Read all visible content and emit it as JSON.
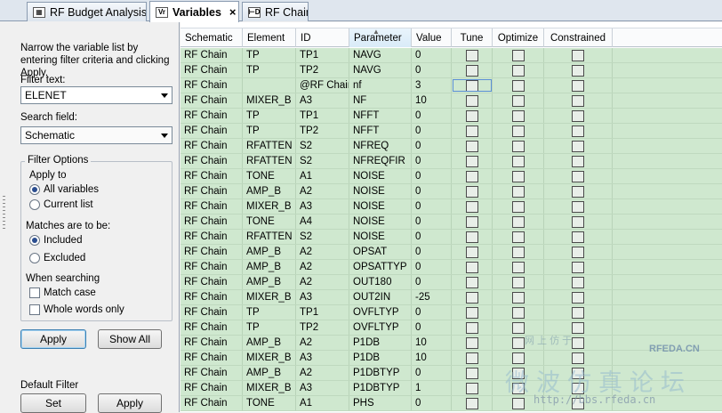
{
  "tabs": [
    {
      "label": "RF Budget Analysis",
      "icon": "chart-icon"
    },
    {
      "label": "Variables",
      "icon": "variables-icon",
      "close": "×"
    },
    {
      "label": "RF Chain",
      "icon": "schematic-icon"
    }
  ],
  "filter_panel": {
    "intro": "Narrow the variable list by entering filter criteria and clicking Apply.",
    "filter_text_label": "Filter text:",
    "filter_text_value": "ELENET",
    "search_field_label": "Search field:",
    "search_field_value": "Schematic",
    "filter_options_title": "Filter Options",
    "apply_to_label": "Apply to",
    "all_variables": "All variables",
    "current_list": "Current list",
    "matches_label": "Matches are to be:",
    "included": "Included",
    "excluded": "Excluded",
    "when_searching_label": "When searching",
    "match_case": "Match case",
    "whole_words": "Whole words only",
    "apply_button": "Apply",
    "show_all_button": "Show All",
    "default_filter_label": "Default Filter",
    "set_button": "Set",
    "apply_default_button": "Apply",
    "selected_apply_to": "All variables",
    "selected_matches": "Included"
  },
  "grid": {
    "columns": [
      "Schematic",
      "Element",
      "ID",
      "Parameter",
      "Value",
      "Tune",
      "Optimize",
      "Constrained"
    ],
    "rows": [
      [
        "RF Chain",
        "TP",
        "TP1",
        "NAVG",
        "0"
      ],
      [
        "RF Chain",
        "TP",
        "TP2",
        "NAVG",
        "0"
      ],
      [
        "RF Chain",
        "",
        "@RF Chain",
        "nf",
        "3"
      ],
      [
        "RF Chain",
        "MIXER_B",
        "A3",
        "NF",
        "10"
      ],
      [
        "RF Chain",
        "TP",
        "TP1",
        "NFFT",
        "0"
      ],
      [
        "RF Chain",
        "TP",
        "TP2",
        "NFFT",
        "0"
      ],
      [
        "RF Chain",
        "RFATTEN",
        "S2",
        "NFREQ",
        "0"
      ],
      [
        "RF Chain",
        "RFATTEN",
        "S2",
        "NFREQFIR",
        "0"
      ],
      [
        "RF Chain",
        "TONE",
        "A1",
        "NOISE",
        "0"
      ],
      [
        "RF Chain",
        "AMP_B",
        "A2",
        "NOISE",
        "0"
      ],
      [
        "RF Chain",
        "MIXER_B",
        "A3",
        "NOISE",
        "0"
      ],
      [
        "RF Chain",
        "TONE",
        "A4",
        "NOISE",
        "0"
      ],
      [
        "RF Chain",
        "RFATTEN",
        "S2",
        "NOISE",
        "0"
      ],
      [
        "RF Chain",
        "AMP_B",
        "A2",
        "OPSAT",
        "0"
      ],
      [
        "RF Chain",
        "AMP_B",
        "A2",
        "OPSATTYP",
        "0"
      ],
      [
        "RF Chain",
        "AMP_B",
        "A2",
        "OUT180",
        "0"
      ],
      [
        "RF Chain",
        "MIXER_B",
        "A3",
        "OUT2IN",
        "-25"
      ],
      [
        "RF Chain",
        "TP",
        "TP1",
        "OVFLTYP",
        "0"
      ],
      [
        "RF Chain",
        "TP",
        "TP2",
        "OVFLTYP",
        "0"
      ],
      [
        "RF Chain",
        "AMP_B",
        "A2",
        "P1DB",
        "10"
      ],
      [
        "RF Chain",
        "MIXER_B",
        "A3",
        "P1DB",
        "10"
      ],
      [
        "RF Chain",
        "AMP_B",
        "A2",
        "P1DBTYP",
        "0"
      ],
      [
        "RF Chain",
        "MIXER_B",
        "A3",
        "P1DBTYP",
        "1"
      ],
      [
        "RF Chain",
        "TONE",
        "A1",
        "PHS",
        "0"
      ]
    ]
  },
  "watermark": {
    "line1": "网 上 仿 于",
    "brand": "RFEDA.CN",
    "chinese": "微波仿真论坛",
    "url": "http://bbs.rfeda.cn"
  }
}
